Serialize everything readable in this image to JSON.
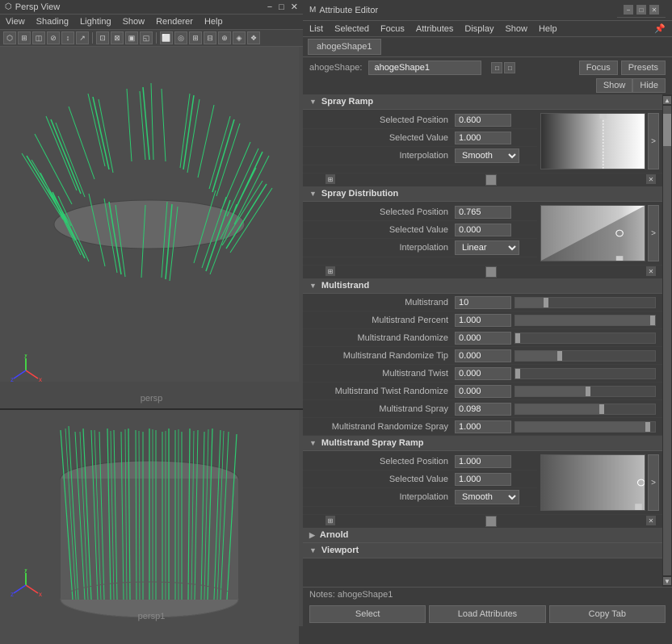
{
  "leftPanel": {
    "titleBar": {
      "icon": "⬡",
      "title": "Persp View"
    },
    "menuItems": [
      "View",
      "Shading",
      "Lighting",
      "Show",
      "Renderer",
      "Help"
    ],
    "viewport1": {
      "label": "persp",
      "background": "#4a4a4a"
    },
    "viewport2": {
      "label": "persp1",
      "background": "#4a4a4a"
    }
  },
  "rightPanel": {
    "titleBar": {
      "title": "Attribute Editor",
      "controls": [
        "−",
        "□",
        "✕"
      ]
    },
    "menuItems": [
      "List",
      "Selected",
      "Focus",
      "Attributes",
      "Display",
      "Show",
      "Help"
    ],
    "pinIcon": "📌",
    "activeTab": "ahogeShape1",
    "nodeName": "ahogeShape:",
    "nodeValue": "ahogeShape1",
    "focusBtn": "Focus",
    "presetsBtn": "Presets",
    "showBtn": "Show",
    "hideBtn": "Hide",
    "sections": [
      {
        "id": "spray-ramp",
        "label": "Spray Ramp",
        "collapsed": false,
        "rows": [
          {
            "label": "Selected Position",
            "value": "0.600",
            "hasSlider": false,
            "isField": true
          },
          {
            "label": "Selected Value",
            "value": "1.000",
            "hasSlider": false,
            "isField": true
          },
          {
            "label": "Interpolation",
            "value": "Smooth",
            "type": "dropdown"
          }
        ],
        "ramp": {
          "gradientType": "spray",
          "markerPos": 0.6
        }
      },
      {
        "id": "spray-distribution",
        "label": "Spray Distribution",
        "collapsed": false,
        "rows": [
          {
            "label": "Selected Position",
            "value": "0.765",
            "hasSlider": false,
            "isField": true
          },
          {
            "label": "Selected Value",
            "value": "0.000",
            "hasSlider": false,
            "isField": true
          },
          {
            "label": "Interpolation",
            "value": "Linear",
            "type": "dropdown"
          }
        ],
        "ramp": {
          "gradientType": "distribution",
          "markerPos": 0.765
        }
      },
      {
        "id": "multistrand",
        "label": "Multistrand",
        "collapsed": false,
        "rows": [
          {
            "label": "Multistrand",
            "value": "10",
            "sliderPct": 20
          },
          {
            "label": "Multistrand Percent",
            "value": "1.000",
            "sliderPct": 100
          },
          {
            "label": "Multistrand Randomize",
            "value": "0.000",
            "sliderPct": 0
          },
          {
            "label": "Multistrand Randomize Tip",
            "value": "0.000",
            "sliderPct": 30
          },
          {
            "label": "Multistrand Twist",
            "value": "0.000",
            "sliderPct": 0
          },
          {
            "label": "Multistrand Twist Randomize",
            "value": "0.000",
            "sliderPct": 50
          },
          {
            "label": "Multistrand Spray",
            "value": "0.098",
            "sliderPct": 60
          },
          {
            "label": "Multistrand Randomize Spray",
            "value": "1.000",
            "sliderPct": 95
          }
        ]
      },
      {
        "id": "multistrand-spray-ramp",
        "label": "Multistrand Spray Ramp",
        "collapsed": false,
        "rows": [
          {
            "label": "Selected Position",
            "value": "1.000",
            "hasSlider": false,
            "isField": true
          },
          {
            "label": "Selected Value",
            "value": "1.000",
            "hasSlider": false,
            "isField": true
          },
          {
            "label": "Interpolation",
            "value": "Smooth",
            "type": "dropdown"
          }
        ],
        "ramp": {
          "gradientType": "multistrand-spray",
          "markerPos": 1.0
        }
      },
      {
        "id": "arnold",
        "label": "Arnold",
        "collapsed": true
      },
      {
        "id": "viewport",
        "label": "Viewport",
        "collapsed": true
      }
    ],
    "notes": "Notes: ahogeShape1",
    "bottomButtons": [
      "Select",
      "Load Attributes",
      "Copy Tab"
    ]
  }
}
